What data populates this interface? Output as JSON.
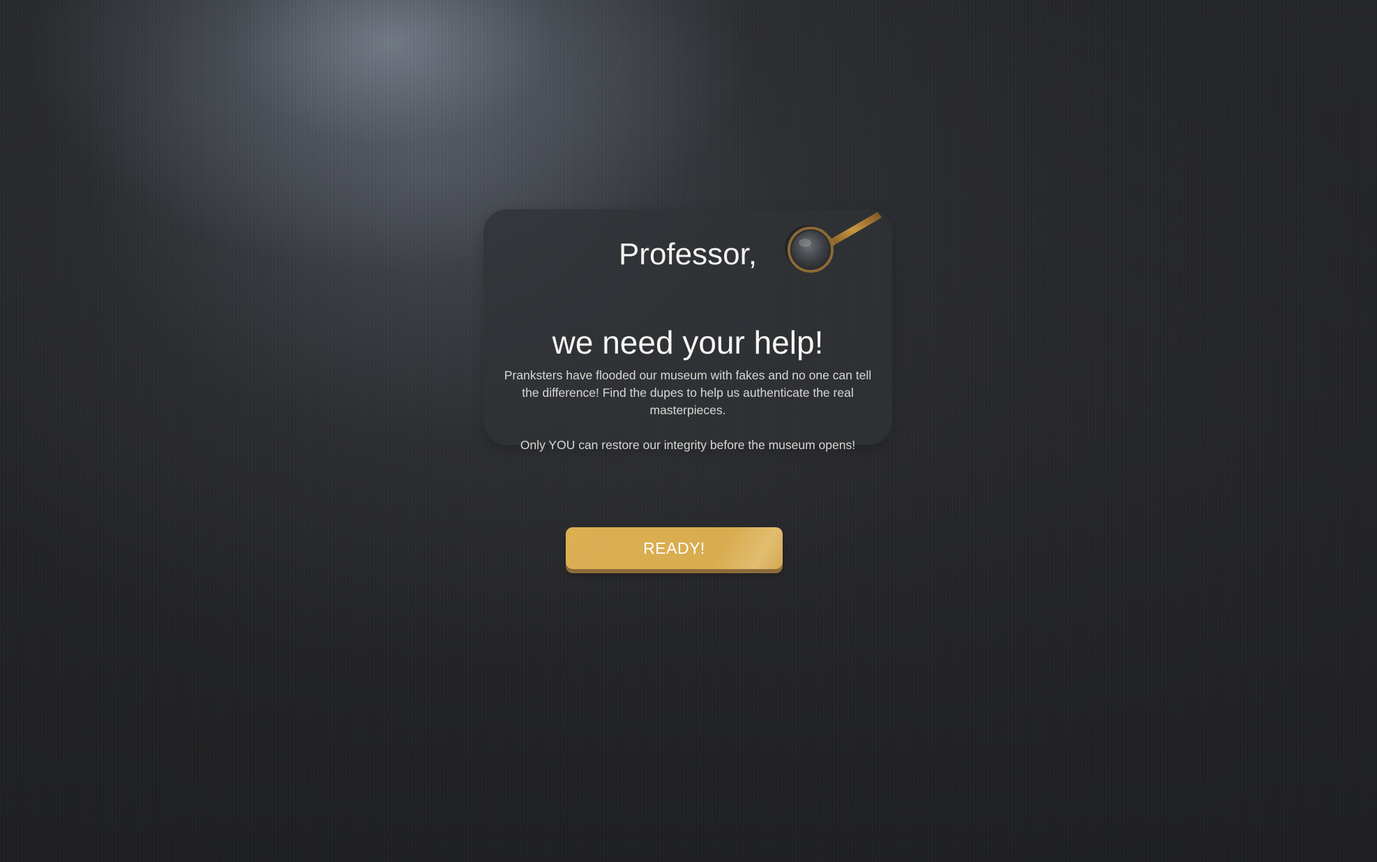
{
  "intro_card": {
    "greeting": "Professor,",
    "headline": "we need your help!",
    "body_line_1": "Pranksters have flooded our museum with fakes and no one can tell the difference! Find the dupes to help us authenticate the real masterpieces.",
    "body_line_2": "Only YOU can restore our integrity before the museum opens!",
    "icon": "magnifying-glass-icon"
  },
  "actions": {
    "ready_label": "READY!"
  },
  "colors": {
    "accent": "#d9ac50",
    "background": "#2a2b2e",
    "card": "#303236"
  }
}
